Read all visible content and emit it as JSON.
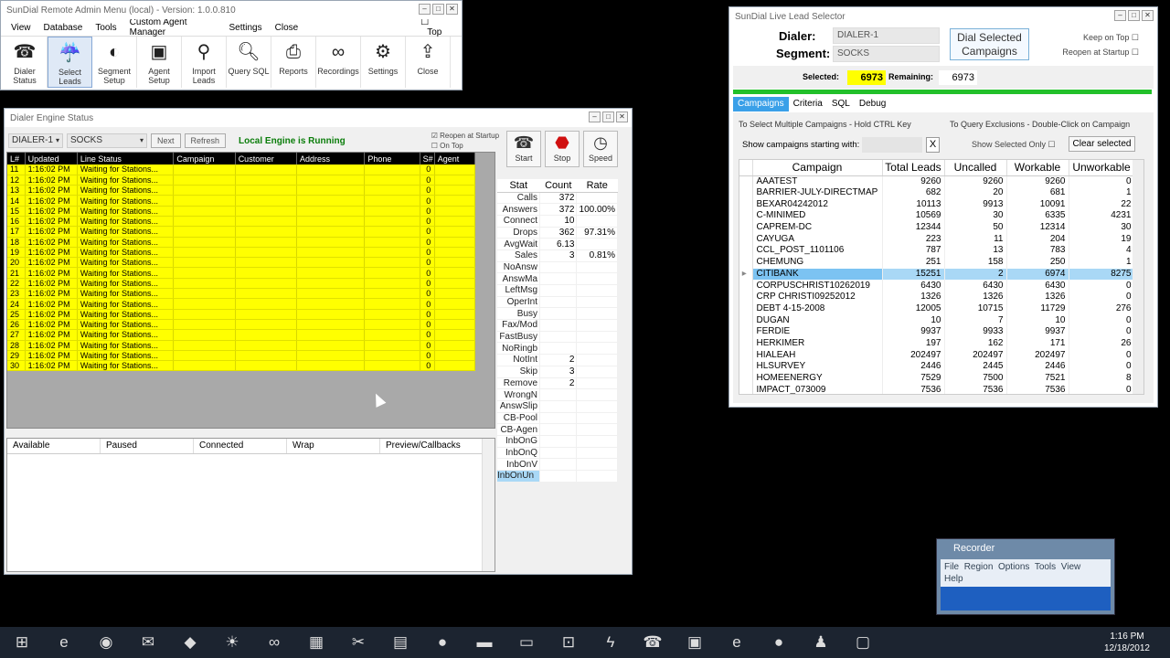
{
  "admin": {
    "title": "SunDial Remote Admin Menu (local) - Version: 1.0.0.810",
    "menu": [
      "View",
      "Database",
      "Tools",
      "Custom Agent Manager",
      "Settings",
      "Close"
    ],
    "top_label": "Top",
    "toolbar": [
      {
        "label": "Dialer Status",
        "icon": "phone-icon"
      },
      {
        "label": "Select Leads",
        "icon": "select-leads-icon"
      },
      {
        "label": "Segment Setup",
        "icon": "segment-icon"
      },
      {
        "label": "Agent Setup",
        "icon": "agent-icon"
      },
      {
        "label": "Import Leads",
        "icon": "import-icon"
      },
      {
        "label": "Query SQL",
        "icon": "magnifier-icon"
      },
      {
        "label": "Reports",
        "icon": "printer-icon"
      },
      {
        "label": "Recordings",
        "icon": "tape-icon"
      },
      {
        "label": "Settings",
        "icon": "gears-icon"
      },
      {
        "label": "Close",
        "icon": "exit-icon"
      }
    ]
  },
  "engine": {
    "title": "Dialer Engine Status",
    "dialer": "DIALER-1",
    "segment": "SOCKS",
    "next": "Next",
    "refresh": "Refresh",
    "status": "Local Engine is Running",
    "reopen": "Reopen at Startup",
    "on_top": "On Top",
    "columns": [
      "L#",
      "Updated",
      "Line Status",
      "Campaign",
      "Customer",
      "Address",
      "Phone",
      "S#",
      "Agent"
    ],
    "rows": [
      [
        "11",
        "1:16:02 PM",
        "Waiting for Stations...",
        "",
        "",
        "",
        "",
        "0",
        ""
      ],
      [
        "12",
        "1:16:02 PM",
        "Waiting for Stations...",
        "",
        "",
        "",
        "",
        "0",
        ""
      ],
      [
        "13",
        "1:16:02 PM",
        "Waiting for Stations...",
        "",
        "",
        "",
        "",
        "0",
        ""
      ],
      [
        "14",
        "1:16:02 PM",
        "Waiting for Stations...",
        "",
        "",
        "",
        "",
        "0",
        ""
      ],
      [
        "15",
        "1:16:02 PM",
        "Waiting for Stations...",
        "",
        "",
        "",
        "",
        "0",
        ""
      ],
      [
        "16",
        "1:16:02 PM",
        "Waiting for Stations...",
        "",
        "",
        "",
        "",
        "0",
        ""
      ],
      [
        "17",
        "1:16:02 PM",
        "Waiting for Stations...",
        "",
        "",
        "",
        "",
        "0",
        ""
      ],
      [
        "18",
        "1:16:02 PM",
        "Waiting for Stations...",
        "",
        "",
        "",
        "",
        "0",
        ""
      ],
      [
        "19",
        "1:16:02 PM",
        "Waiting for Stations...",
        "",
        "",
        "",
        "",
        "0",
        ""
      ],
      [
        "20",
        "1:16:02 PM",
        "Waiting for Stations...",
        "",
        "",
        "",
        "",
        "0",
        ""
      ],
      [
        "21",
        "1:16:02 PM",
        "Waiting for Stations...",
        "",
        "",
        "",
        "",
        "0",
        ""
      ],
      [
        "22",
        "1:16:02 PM",
        "Waiting for Stations...",
        "",
        "",
        "",
        "",
        "0",
        ""
      ],
      [
        "23",
        "1:16:02 PM",
        "Waiting for Stations...",
        "",
        "",
        "",
        "",
        "0",
        ""
      ],
      [
        "24",
        "1:16:02 PM",
        "Waiting for Stations...",
        "",
        "",
        "",
        "",
        "0",
        ""
      ],
      [
        "25",
        "1:16:02 PM",
        "Waiting for Stations...",
        "",
        "",
        "",
        "",
        "0",
        ""
      ],
      [
        "26",
        "1:16:02 PM",
        "Waiting for Stations...",
        "",
        "",
        "",
        "",
        "0",
        ""
      ],
      [
        "27",
        "1:16:02 PM",
        "Waiting for Stations...",
        "",
        "",
        "",
        "",
        "0",
        ""
      ],
      [
        "28",
        "1:16:02 PM",
        "Waiting for Stations...",
        "",
        "",
        "",
        "",
        "0",
        ""
      ],
      [
        "29",
        "1:16:02 PM",
        "Waiting for Stations...",
        "",
        "",
        "",
        "",
        "0",
        ""
      ],
      [
        "30",
        "1:16:02 PM",
        "Waiting for Stations...",
        "",
        "",
        "",
        "",
        "0",
        ""
      ]
    ],
    "agent_columns": [
      "Available",
      "Paused",
      "Connected",
      "Wrap",
      "Preview/Callbacks"
    ],
    "controls": [
      {
        "label": "Start",
        "icon": "phone-icon"
      },
      {
        "label": "Stop",
        "icon": "stop-sign-icon"
      },
      {
        "label": "Speed",
        "icon": "speedometer-icon"
      }
    ],
    "stat_headers": [
      "Stat",
      "Count",
      "Rate"
    ],
    "stats": [
      [
        "Calls",
        "372",
        ""
      ],
      [
        "Answers",
        "372",
        "100.00%"
      ],
      [
        "Connect",
        "10",
        ""
      ],
      [
        "Drops",
        "362",
        "97.31%"
      ],
      [
        "AvgWait",
        "6.13",
        ""
      ],
      [
        "Sales",
        "3",
        "0.81%"
      ],
      [
        "NoAnsw",
        "",
        ""
      ],
      [
        "AnswMa",
        "",
        ""
      ],
      [
        "LeftMsg",
        "",
        ""
      ],
      [
        "OperInt",
        "",
        ""
      ],
      [
        "Busy",
        "",
        ""
      ],
      [
        "Fax/Mod",
        "",
        ""
      ],
      [
        "FastBusy",
        "",
        ""
      ],
      [
        "NoRingb",
        "",
        ""
      ],
      [
        "NotInt",
        "2",
        ""
      ],
      [
        "Skip",
        "3",
        ""
      ],
      [
        "Remove",
        "2",
        ""
      ],
      [
        "WrongN",
        "",
        ""
      ],
      [
        "AnswSlip",
        "",
        ""
      ],
      [
        "CB-Pool",
        "",
        ""
      ],
      [
        "CB-Agen",
        "",
        ""
      ],
      [
        "InbOnG",
        "",
        ""
      ],
      [
        "InbOnQ",
        "",
        ""
      ],
      [
        "InbOnV",
        "",
        ""
      ],
      [
        "InbOnUn",
        "",
        ""
      ]
    ]
  },
  "lead": {
    "title": "SunDial Live Lead Selector",
    "dialer_label": "Dialer:",
    "dialer_value": "DIALER-1",
    "segment_label": "Segment:",
    "segment_value": "SOCKS",
    "dial_button": "Dial Selected Campaigns",
    "keep_on_top": "Keep on Top",
    "reopen": "Reopen at Startup",
    "selected_label": "Selected:",
    "selected_value": "6973",
    "remaining_label": "Remaining:",
    "remaining_value": "6973",
    "tabs": [
      "Campaigns",
      "Criteria",
      "SQL",
      "Debug"
    ],
    "hint_left": "To Select Multiple Campaigns - Hold CTRL Key",
    "hint_right": "To Query Exclusions - Double-Click on Campaign",
    "filter_label": "Show campaigns starting with:",
    "clear_x": "X",
    "show_selected": "Show Selected Only",
    "clear_selected": "Clear selected",
    "columns": [
      "Campaign",
      "Total Leads",
      "Uncalled",
      "Workable",
      "Unworkable"
    ],
    "rows": [
      [
        "AAATEST",
        "9260",
        "9260",
        "9260",
        "0"
      ],
      [
        "BARRIER-JULY-DIRECTMAP",
        "682",
        "20",
        "681",
        "1"
      ],
      [
        "BEXAR04242012",
        "10113",
        "9913",
        "10091",
        "22"
      ],
      [
        "C-MINIMED",
        "10569",
        "30",
        "6335",
        "4231"
      ],
      [
        "CAPREM-DC",
        "12344",
        "50",
        "12314",
        "30"
      ],
      [
        "CAYUGA",
        "223",
        "11",
        "204",
        "19"
      ],
      [
        "CCL_POST_1101106",
        "787",
        "13",
        "783",
        "4"
      ],
      [
        "CHEMUNG",
        "251",
        "158",
        "250",
        "1"
      ],
      [
        "CITIBANK",
        "15251",
        "2",
        "6974",
        "8275"
      ],
      [
        "CORPUSCHRIST10262019",
        "6430",
        "6430",
        "6430",
        "0"
      ],
      [
        "CRP CHRISTI09252012",
        "1326",
        "1326",
        "1326",
        "0"
      ],
      [
        "DEBT 4-15-2008",
        "12005",
        "10715",
        "11729",
        "276"
      ],
      [
        "DUGAN",
        "10",
        "7",
        "10",
        "0"
      ],
      [
        "FERDIE",
        "9937",
        "9933",
        "9937",
        "0"
      ],
      [
        "HERKIMER",
        "197",
        "162",
        "171",
        "26"
      ],
      [
        "HIALEAH",
        "202497",
        "202497",
        "202497",
        "0"
      ],
      [
        "HLSURVEY",
        "2446",
        "2445",
        "2446",
        "0"
      ],
      [
        "HOMEENERGY",
        "7529",
        "7500",
        "7521",
        "8"
      ],
      [
        "IMPACT_073009",
        "7536",
        "7536",
        "7536",
        "0"
      ]
    ],
    "selected_row": 8
  },
  "recorder": {
    "title": "Recorder",
    "menu": [
      "File",
      "Region",
      "Options",
      "Tools",
      "View",
      "Help"
    ]
  },
  "taskbar": {
    "time": "1:16 PM",
    "date": "12/18/2012"
  }
}
